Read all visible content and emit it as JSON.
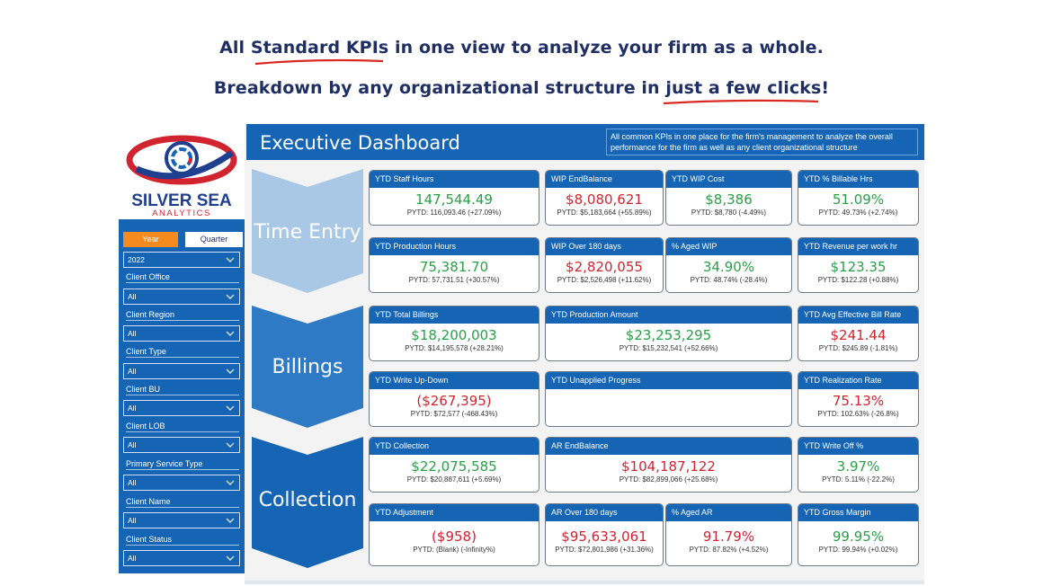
{
  "headline": {
    "line1": "All Standard KPIs in one view to analyze your firm as a whole.",
    "line2": "Breakdown by any organizational structure in just a few clicks!"
  },
  "logo": {
    "line1": "SILVER SEA",
    "line2": "ANALYTICS"
  },
  "filters": {
    "toggle_year": "Year",
    "toggle_quarter": "Quarter",
    "year_value": "2022",
    "items": [
      {
        "label": "Client Office",
        "value": "All"
      },
      {
        "label": "Client Region",
        "value": "All"
      },
      {
        "label": "Client Type",
        "value": "All"
      },
      {
        "label": "Client BU",
        "value": "All"
      },
      {
        "label": "Client LOB",
        "value": "All"
      },
      {
        "label": "Primary Service Type",
        "value": "All"
      },
      {
        "label": "Client Name",
        "value": "All"
      },
      {
        "label": "Client Status",
        "value": "All"
      }
    ]
  },
  "dashboard": {
    "title": "Executive Dashboard",
    "description": "All common KPIs in one place for the firm's management to analyze the overall performance for the firm as well as any client organizational structure"
  },
  "sections": [
    "Time Entry",
    "Billings",
    "Collection"
  ],
  "cards": [
    {
      "title": "YTD Staff Hours",
      "value": "147,544.49",
      "sub": "PYTD: 116,093.46 (+27.09%)",
      "color": "green"
    },
    {
      "title": "WIP EndBalance",
      "value": "$8,080,621",
      "sub": "PYTD: $5,183,664 (+55.89%)",
      "color": "red"
    },
    {
      "title": "YTD WIP Cost",
      "value": "$8,386",
      "sub": "PYTD: $8,780 (-4.49%)",
      "color": "green"
    },
    {
      "title": "YTD % Billable Hrs",
      "value": "51.09%",
      "sub": "PYTD: 49.73% (+2.74%)",
      "color": "green"
    },
    {
      "title": "YTD Production Hours",
      "value": "75,381.70",
      "sub": "PYTD: 57,731.51 (+30.57%)",
      "color": "green"
    },
    {
      "title": "WIP Over 180 days",
      "value": "$2,820,055",
      "sub": "PYTD: $2,526,498 (+11.62%)",
      "color": "red"
    },
    {
      "title": "% Aged WIP",
      "value": "34.90%",
      "sub": "PYTD: 48.74% (-28.4%)",
      "color": "green"
    },
    {
      "title": "YTD Revenue per work hr",
      "value": "$123.35",
      "sub": "PYTD: $122.28 (+0.88%)",
      "color": "green"
    },
    {
      "title": "YTD Total Billings",
      "value": "$18,200,003",
      "sub": "PYTD: $14,195,578 (+28.21%)",
      "color": "green"
    },
    {
      "title": "YTD Production Amount",
      "value": "$23,253,295",
      "sub": "PYTD: $15,232,541 (+52.66%)",
      "color": "green"
    },
    {
      "title": "YTD Avg Effective Bill Rate",
      "value": "$241.44",
      "sub": "PYTD: $245.89 (-1.81%)",
      "color": "red"
    },
    {
      "title": "YTD Write Up-Down",
      "value": "($267,395)",
      "sub": "PYTD: $72,577 (-468.43%)",
      "color": "red"
    },
    {
      "title": "YTD Unapplied Progress",
      "value": "",
      "sub": "",
      "color": "green"
    },
    {
      "title": "YTD Realization Rate",
      "value": "75.13%",
      "sub": "PYTD: 102.63% (-26.8%)",
      "color": "red"
    },
    {
      "title": "YTD Collection",
      "value": "$22,075,585",
      "sub": "PYTD: $20,887,611 (+5.69%)",
      "color": "green"
    },
    {
      "title": "AR EndBalance",
      "value": "$104,187,122",
      "sub": "PYTD: $82,899,066 (+25.68%)",
      "color": "red"
    },
    {
      "title": "YTD Write Off %",
      "value": "3.97%",
      "sub": "PYTD: 5.11% (-22.2%)",
      "color": "green"
    },
    {
      "title": "YTD Adjustment",
      "value": "($958)",
      "sub": "PYTD: (Blank) (-Infinity%)",
      "color": "red"
    },
    {
      "title": "AR Over 180 days",
      "value": "$95,633,061",
      "sub": "PYTD: $72,801,986 (+31.36%)",
      "color": "red"
    },
    {
      "title": "% Aged AR",
      "value": "91.79%",
      "sub": "PYTD: 87.82% (+4.52%)",
      "color": "red"
    },
    {
      "title": "YTD Gross Margin",
      "value": "99.95%",
      "sub": "PYTD: 99.94% (+0.02%)",
      "color": "green"
    }
  ],
  "colors": {
    "accent": "#1565b4",
    "orange": "#f58a1f",
    "green": "#27a046",
    "red": "#d1242f",
    "chevron": "#a9c8e6"
  }
}
